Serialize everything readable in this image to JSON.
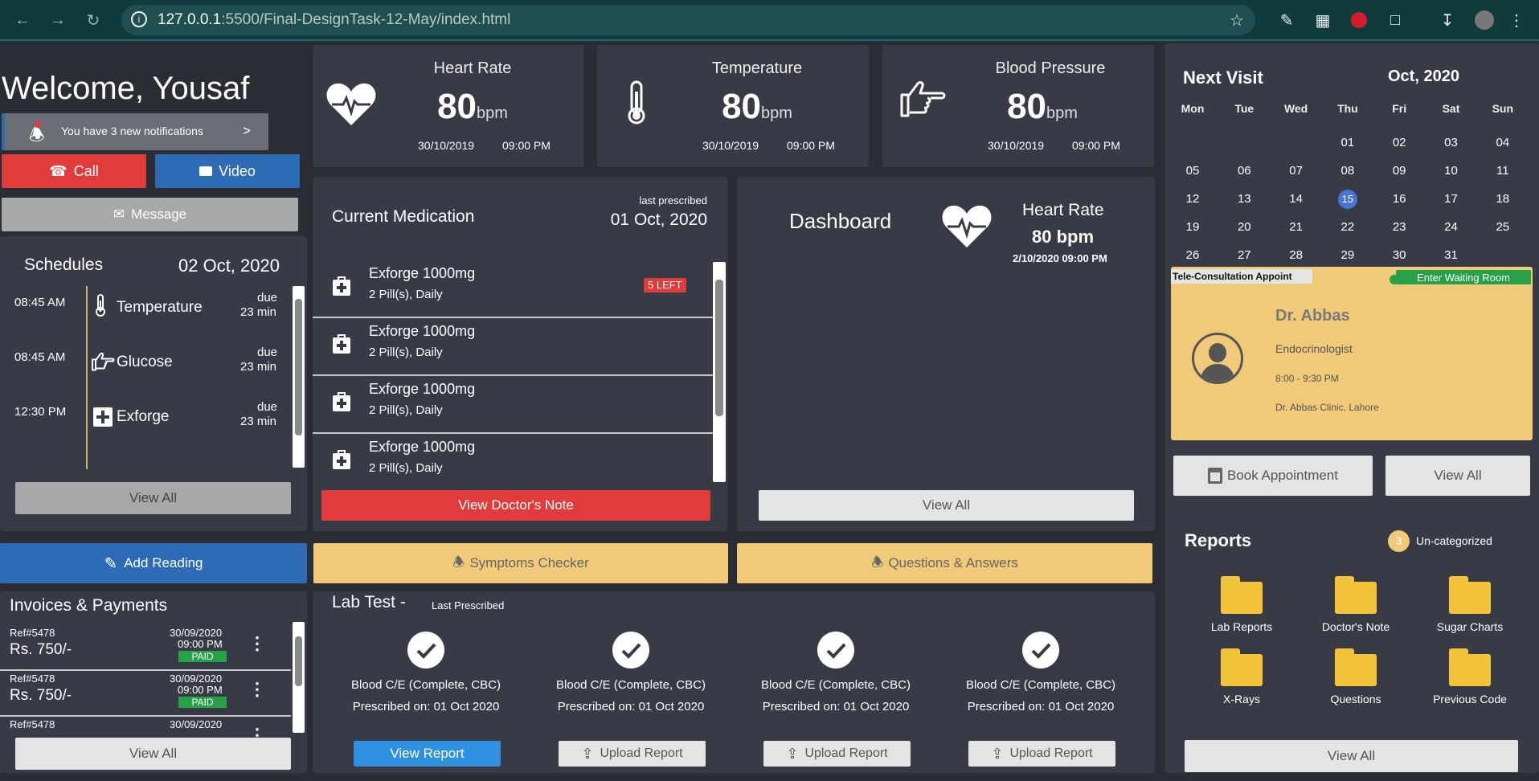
{
  "browser": {
    "url_host": "127.0.0.1",
    "url_path": ":5500/Final-DesignTask-12-May/index.html"
  },
  "welcome": {
    "greeting": "Welcome, Yousaf",
    "notification_text": "You have 3 new notifications",
    "notification_arrow": ">",
    "call_label": "Call",
    "video_label": "Video",
    "message_label": "Message"
  },
  "vitals": [
    {
      "title": "Heart Rate",
      "value": "80",
      "unit": "bpm",
      "date": "30/10/2019",
      "time": "09:00 PM",
      "icon": "heart-pulse-icon"
    },
    {
      "title": "Temperature",
      "value": "80",
      "unit": "bpm",
      "date": "30/10/2019",
      "time": "09:00 PM",
      "icon": "thermometer-icon"
    },
    {
      "title": "Blood Pressure",
      "value": "80",
      "unit": "bpm",
      "date": "30/10/2019",
      "time": "09:00 PM",
      "icon": "pointing-hand-icon"
    }
  ],
  "schedules": {
    "title": "Schedules",
    "date": "02 Oct, 2020",
    "items": [
      {
        "time": "08:45 AM",
        "label": "Temperature",
        "due": "due",
        "mins": "23 min",
        "icon": "thermometer-icon"
      },
      {
        "time": "08:45 AM",
        "label": "Glucose",
        "due": "due",
        "mins": "23 min",
        "icon": "pointing-hand-icon"
      },
      {
        "time": "12:30 PM",
        "label": "Exforge",
        "due": "due",
        "mins": "23 min",
        "icon": "plus-box-icon"
      }
    ],
    "view_all": "View All"
  },
  "medication": {
    "title": "Current Medication",
    "last_label": "last prescribed",
    "last_date": "01 Oct, 2020",
    "items": [
      {
        "name": "Exforge 1000mg",
        "dose": "2 Pill(s), Daily",
        "badge": "5 LEFT"
      },
      {
        "name": "Exforge 1000mg",
        "dose": "2 Pill(s), Daily",
        "badge": ""
      },
      {
        "name": "Exforge 1000mg",
        "dose": "2 Pill(s), Daily",
        "badge": ""
      },
      {
        "name": "Exforge 1000mg",
        "dose": "2 Pill(s), Daily",
        "badge": ""
      }
    ],
    "note_button": "View Doctor's Note"
  },
  "dashboard": {
    "title": "Dashboard",
    "hr_title": "Heart Rate",
    "hr_value": "80 bpm",
    "hr_time": "2/10/2020 09:00 PM",
    "view_all": "View All"
  },
  "next_visit": {
    "title": "Next Visit",
    "month": "Oct, 2020",
    "weekdays": [
      "Mon",
      "Tue",
      "Wed",
      "Thu",
      "Fri",
      "Sat",
      "Sun"
    ],
    "weeks": [
      [
        "",
        "",
        "",
        "01",
        "02",
        "03",
        "04"
      ],
      [
        "05",
        "06",
        "07",
        "08",
        "09",
        "10",
        "11"
      ],
      [
        "12",
        "13",
        "14",
        "15",
        "16",
        "17",
        "18"
      ],
      [
        "19",
        "20",
        "21",
        "22",
        "23",
        "24",
        "25"
      ],
      [
        "26",
        "27",
        "28",
        "29",
        "30",
        "31",
        ""
      ]
    ],
    "selected_day": "15",
    "appointment": {
      "tag": "Tele-Consultation Appoint",
      "waiting_room": "Enter Waiting Room",
      "doctor": "Dr. Abbas",
      "speciality": "Endocrinologist",
      "hours": "8:00 - 9:30 PM",
      "clinic": "Dr. Abbas Clinic, Lahore"
    },
    "book_label": "Book Appointment",
    "view_all": "View All"
  },
  "actions": {
    "add_reading": "Add Reading",
    "symptoms": "Symptoms Checker",
    "qa": "Questions & Answers"
  },
  "invoices": {
    "title": "Invoices & Payments",
    "items": [
      {
        "ref": "Ref#5478",
        "amount": "Rs. 750/-",
        "date": "30/09/2020",
        "time": "09:00 PM",
        "status": "PAID"
      },
      {
        "ref": "Ref#5478",
        "amount": "Rs. 750/-",
        "date": "30/09/2020",
        "time": "09:00 PM",
        "status": "PAID"
      },
      {
        "ref": "Ref#5478",
        "amount": "",
        "date": "30/09/2020",
        "time": "",
        "status": ""
      }
    ],
    "view_all": "View All"
  },
  "lab": {
    "title": "Lab Test -",
    "subtitle": "Last Prescribed",
    "tests": [
      {
        "name": "Blood C/E (Complete, CBC)",
        "prescribed": "Prescribed on: 01 Oct 2020",
        "action": "View Report"
      },
      {
        "name": "Blood C/E (Complete, CBC)",
        "prescribed": "Prescribed on: 01 Oct 2020",
        "action": "Upload Report"
      },
      {
        "name": "Blood C/E (Complete, CBC)",
        "prescribed": "Prescribed on: 01 Oct 2020",
        "action": "Upload Report"
      },
      {
        "name": "Blood C/E (Complete, CBC)",
        "prescribed": "Prescribed on: 01 Oct 2020",
        "action": "Upload Report"
      }
    ]
  },
  "reports": {
    "title": "Reports",
    "count": "3",
    "uncategorized": "Un-categorized",
    "folders": [
      "Lab Reports",
      "Doctor's Note",
      "Sugar Charts",
      "X-Rays",
      "Questions",
      "Previous Code"
    ],
    "view_all": "View All"
  },
  "colors": {
    "call": "#e03c3c",
    "video": "#2e6bb5",
    "accent_yellow": "#f0ca78",
    "paid": "#27a047",
    "calendar_selected": "#4a73d8"
  }
}
